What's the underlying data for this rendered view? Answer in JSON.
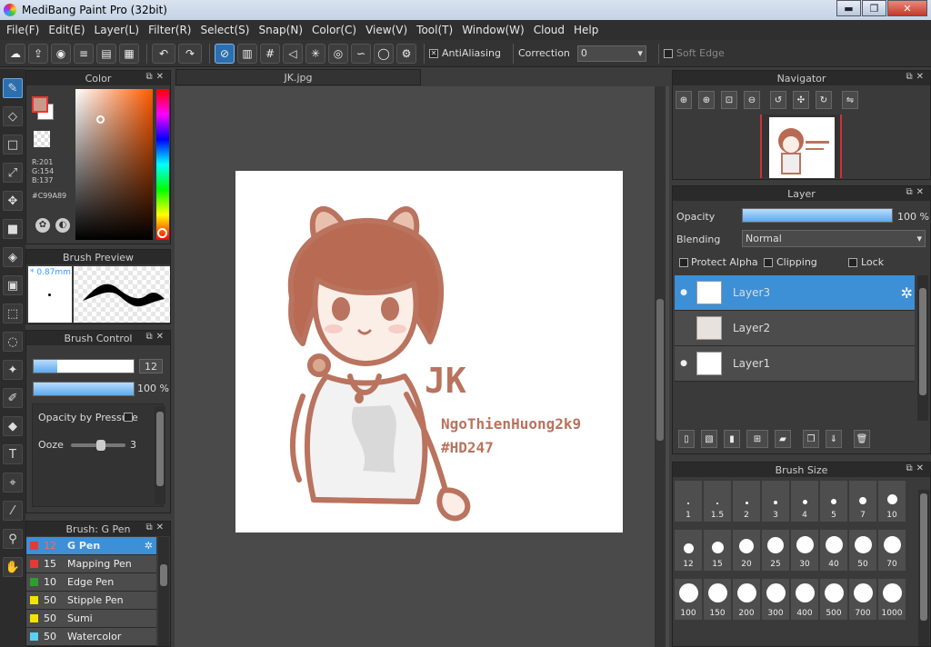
{
  "window": {
    "title": "MediBang Paint Pro (32bit)",
    "minimize": "▬",
    "maximize": "❐",
    "close": "✕"
  },
  "menu": [
    "File(F)",
    "Edit(E)",
    "Layer(L)",
    "Filter(R)",
    "Select(S)",
    "Snap(N)",
    "Color(C)",
    "View(V)",
    "Tool(T)",
    "Window(W)",
    "Cloud",
    "Help"
  ],
  "toolbar": {
    "antialiasing_label": "AntiAliasing",
    "correction_label": "Correction",
    "correction_value": "0",
    "soft_edge_label": "Soft Edge"
  },
  "color_panel": {
    "title": "Color",
    "r": "R:201",
    "g": "G:154",
    "b": "B:137",
    "hex": "#C99A89",
    "primary": "#C99A89",
    "secondary": "#ffffff"
  },
  "brush_preview": {
    "title": "Brush Preview",
    "size": "* 0.87mm"
  },
  "brush_control": {
    "title": "Brush Control",
    "size_value": "12",
    "size_fraction": 0.24,
    "opacity_value": "100 %",
    "opacity_fraction": 1.0,
    "opacity_pressure_label": "Opacity by Pressure",
    "ooze_label": "Ooze",
    "ooze_value": "3"
  },
  "brush_list": {
    "title": "Brush: G Pen",
    "items": [
      {
        "size": "12",
        "name": "G Pen",
        "color": "#e53935",
        "selected": true
      },
      {
        "size": "15",
        "name": "Mapping Pen",
        "color": "#e53935"
      },
      {
        "size": "10",
        "name": "Edge Pen",
        "color": "#2e9e2e"
      },
      {
        "size": "50",
        "name": "Stipple Pen",
        "color": "#f2e400"
      },
      {
        "size": "50",
        "name": "Sumi",
        "color": "#f2e400"
      },
      {
        "size": "50",
        "name": "Watercolor",
        "color": "#5ad0f0"
      }
    ]
  },
  "document": {
    "tab": "JK.jpg"
  },
  "artwork": {
    "text_main": "JK",
    "text_name": "NgoThienHuong2k9",
    "text_tag": "#HD247"
  },
  "navigator": {
    "title": "Navigator"
  },
  "layer_panel": {
    "title": "Layer",
    "opacity_label": "Opacity",
    "opacity_value": "100 %",
    "opacity_fraction": 1.0,
    "blending_label": "Blending",
    "blending_value": "Normal",
    "protect_alpha": "Protect Alpha",
    "clipping": "Clipping",
    "lock": "Lock",
    "layers": [
      {
        "name": "Layer3",
        "visible": true,
        "selected": true
      },
      {
        "name": "Layer2",
        "visible": false
      },
      {
        "name": "Layer1",
        "visible": true
      }
    ]
  },
  "brush_size": {
    "title": "Brush Size",
    "sizes": [
      "1",
      "1.5",
      "2",
      "3",
      "4",
      "5",
      "7",
      "10",
      "12",
      "15",
      "20",
      "25",
      "30",
      "40",
      "50",
      "70",
      "100",
      "150",
      "200",
      "300",
      "400",
      "500",
      "700",
      "1000"
    ]
  }
}
